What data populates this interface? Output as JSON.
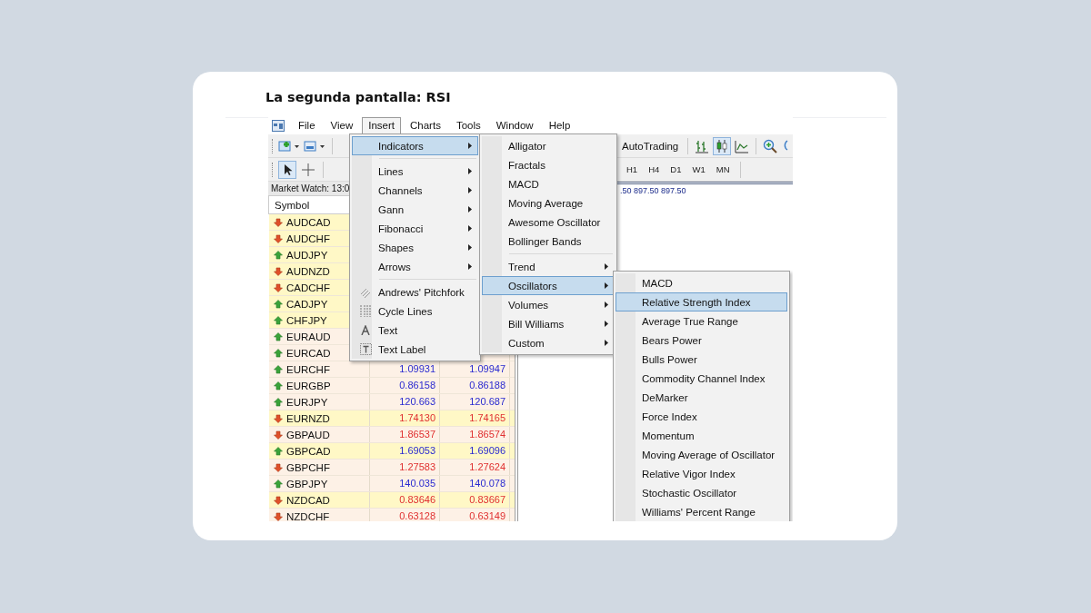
{
  "heading": "La segunda pantalla: RSI",
  "menubar": [
    {
      "label": "File",
      "selected": false
    },
    {
      "label": "View",
      "selected": false
    },
    {
      "label": "Insert",
      "selected": true
    },
    {
      "label": "Charts",
      "selected": false
    },
    {
      "label": "Tools",
      "selected": false
    },
    {
      "label": "Window",
      "selected": false
    },
    {
      "label": "Help",
      "selected": false
    }
  ],
  "toolbar": {
    "autotrading": "AutoTrading",
    "timeframes": [
      "H1",
      "H4",
      "D1",
      "W1",
      "MN"
    ]
  },
  "market_watch": {
    "title": "Market Watch: 13:0",
    "columns": [
      "Symbol"
    ],
    "rows": [
      {
        "symbol": "AUDCAD",
        "rising": false,
        "highlighted": true
      },
      {
        "symbol": "AUDCHF",
        "rising": false,
        "highlighted": true
      },
      {
        "symbol": "AUDJPY",
        "rising": true,
        "highlighted": true
      },
      {
        "symbol": "AUDNZD",
        "rising": false,
        "highlighted": true
      },
      {
        "symbol": "CADCHF",
        "rising": false,
        "highlighted": true
      },
      {
        "symbol": "CADJPY",
        "rising": true,
        "highlighted": true
      },
      {
        "symbol": "CHFJPY",
        "rising": true,
        "highlighted": true
      },
      {
        "symbol": "EURAUD",
        "rising": true,
        "highlighted": false
      },
      {
        "symbol": "EURCAD",
        "rising": true,
        "highlighted": false
      },
      {
        "symbol": "EURCHF",
        "rising": true,
        "highlighted": false,
        "bid": "1.09931",
        "ask": "1.09947"
      },
      {
        "symbol": "EURGBP",
        "rising": true,
        "highlighted": false,
        "bid": "0.86158",
        "ask": "0.86188"
      },
      {
        "symbol": "EURJPY",
        "rising": true,
        "highlighted": false,
        "bid": "120.663",
        "ask": "120.687"
      },
      {
        "symbol": "EURNZD",
        "rising": false,
        "highlighted": true,
        "bid": "1.74130",
        "ask": "1.74165"
      },
      {
        "symbol": "GBPAUD",
        "rising": false,
        "highlighted": false,
        "bid": "1.86537",
        "ask": "1.86574"
      },
      {
        "symbol": "GBPCAD",
        "rising": true,
        "highlighted": true,
        "bid": "1.69053",
        "ask": "1.69096"
      },
      {
        "symbol": "GBPCHF",
        "rising": false,
        "highlighted": false,
        "bid": "1.27583",
        "ask": "1.27624"
      },
      {
        "symbol": "GBPJPY",
        "rising": true,
        "highlighted": false,
        "bid": "140.035",
        "ask": "140.078"
      },
      {
        "symbol": "NZDCAD",
        "rising": false,
        "highlighted": true,
        "bid": "0.83646",
        "ask": "0.83667"
      },
      {
        "symbol": "NZDCHF",
        "rising": false,
        "highlighted": false,
        "bid": "0.63128",
        "ask": "0.63149"
      }
    ]
  },
  "chart": {
    "price_line": ".50 897.50 897.50"
  },
  "insert_menu": [
    {
      "items": [
        {
          "label": "Indicators",
          "submenu": true,
          "selected": true
        }
      ]
    },
    {
      "items": [
        {
          "label": "Lines",
          "submenu": true,
          "selected": false
        },
        {
          "label": "Channels",
          "submenu": true,
          "selected": false
        },
        {
          "label": "Gann",
          "submenu": true,
          "selected": false
        },
        {
          "label": "Fibonacci",
          "submenu": true,
          "selected": false
        },
        {
          "label": "Shapes",
          "submenu": true,
          "selected": false
        },
        {
          "label": "Arrows",
          "submenu": true,
          "selected": false
        }
      ]
    },
    {
      "icons": true,
      "items": [
        {
          "label": "Andrews' Pitchfork",
          "submenu": false,
          "selected": false
        },
        {
          "label": "Cycle Lines",
          "submenu": false,
          "selected": false
        },
        {
          "label": "Text",
          "submenu": false,
          "selected": false
        },
        {
          "label": "Text Label",
          "submenu": false,
          "selected": false
        }
      ]
    }
  ],
  "indicators_menu": [
    {
      "items": [
        {
          "label": "Alligator",
          "submenu": false,
          "selected": false
        },
        {
          "label": "Fractals",
          "submenu": false,
          "selected": false
        },
        {
          "label": "MACD",
          "submenu": false,
          "selected": false
        },
        {
          "label": "Moving Average",
          "submenu": false,
          "selected": false
        },
        {
          "label": "Awesome Oscillator",
          "submenu": false,
          "selected": false
        },
        {
          "label": "Bollinger Bands",
          "submenu": false,
          "selected": false
        }
      ]
    },
    {
      "items": [
        {
          "label": "Trend",
          "submenu": true,
          "selected": false
        },
        {
          "label": "Oscillators",
          "submenu": true,
          "selected": true
        },
        {
          "label": "Volumes",
          "submenu": true,
          "selected": false
        },
        {
          "label": "Bill Williams",
          "submenu": true,
          "selected": false
        },
        {
          "label": "Custom",
          "submenu": true,
          "selected": false
        }
      ]
    }
  ],
  "oscillators_menu": [
    {
      "items": [
        {
          "label": "MACD",
          "submenu": false,
          "selected": false
        },
        {
          "label": "Relative Strength Index",
          "submenu": false,
          "selected": true
        },
        {
          "label": "Average True Range",
          "submenu": false,
          "selected": false
        },
        {
          "label": "Bears Power",
          "submenu": false,
          "selected": false
        },
        {
          "label": "Bulls Power",
          "submenu": false,
          "selected": false
        },
        {
          "label": "Commodity Channel Index",
          "submenu": false,
          "selected": false
        },
        {
          "label": "DeMarker",
          "submenu": false,
          "selected": false
        },
        {
          "label": "Force Index",
          "submenu": false,
          "selected": false
        },
        {
          "label": "Momentum",
          "submenu": false,
          "selected": false
        },
        {
          "label": "Moving Average of Oscillator",
          "submenu": false,
          "selected": false
        },
        {
          "label": "Relative Vigor Index",
          "submenu": false,
          "selected": false
        },
        {
          "label": "Stochastic Oscillator",
          "submenu": false,
          "selected": false
        },
        {
          "label": "Williams' Percent Range",
          "submenu": false,
          "selected": false
        }
      ]
    }
  ]
}
